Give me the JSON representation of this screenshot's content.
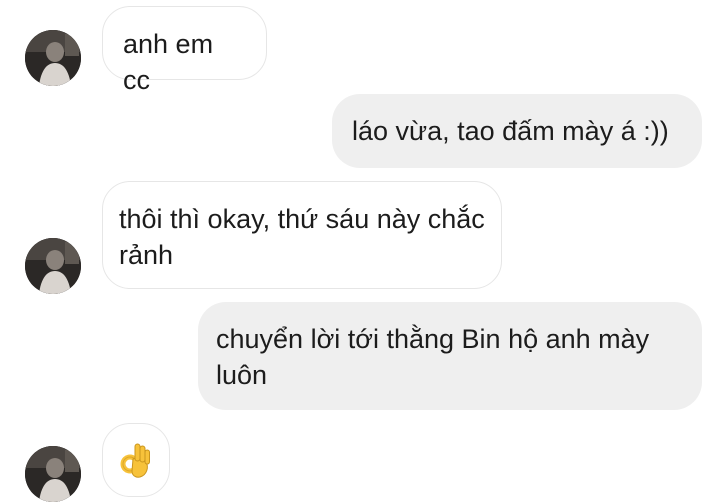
{
  "messages": [
    {
      "direction": "incoming",
      "text": "anh em cc",
      "has_avatar": true
    },
    {
      "direction": "outgoing",
      "text": "láo vừa, tao đấm mày á :))"
    },
    {
      "direction": "incoming",
      "text": "thôi thì okay, thứ sáu này chắc rảnh",
      "has_avatar": true
    },
    {
      "direction": "outgoing",
      "text": "chuyển lời tới thằng Bin hộ anh mày luôn"
    },
    {
      "direction": "incoming",
      "icon": "ok-hand-emoji-icon",
      "has_avatar": true
    }
  ],
  "colors": {
    "outgoing_bubble": "#efefef",
    "incoming_bubble": "#ffffff",
    "incoming_border": "#e6e6e6",
    "text": "#1c1c1c",
    "emoji": "#f7c23a"
  }
}
